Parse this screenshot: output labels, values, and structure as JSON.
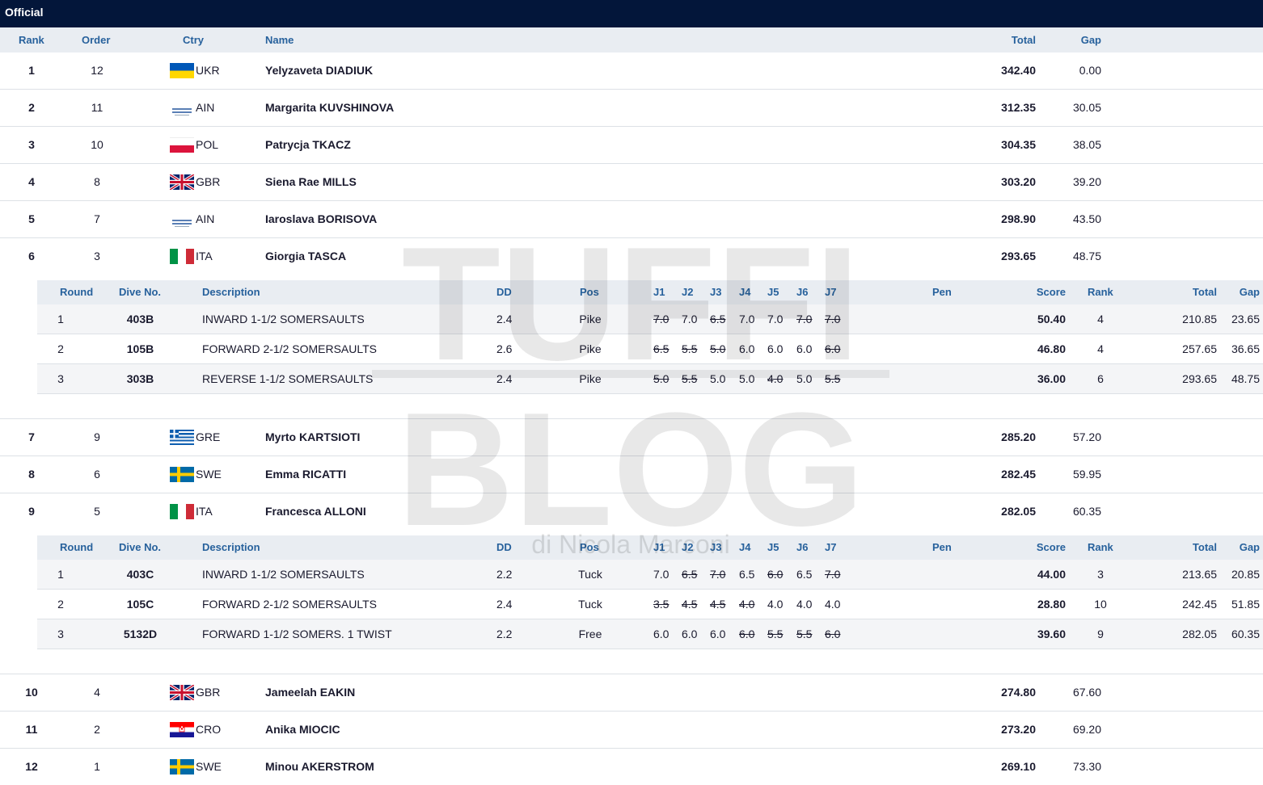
{
  "status": "Official",
  "headers": {
    "rank": "Rank",
    "order": "Order",
    "ctry": "Ctry",
    "name": "Name",
    "total": "Total",
    "gap": "Gap"
  },
  "detail_headers": {
    "round": "Round",
    "dive": "Dive No.",
    "desc": "Description",
    "dd": "DD",
    "pos": "Pos",
    "j1": "J1",
    "j2": "J2",
    "j3": "J3",
    "j4": "J4",
    "j5": "J5",
    "j6": "J6",
    "j7": "J7",
    "pen": "Pen",
    "score": "Score",
    "rank": "Rank",
    "total": "Total",
    "gap": "Gap"
  },
  "rows": [
    {
      "rank": "1",
      "order": "12",
      "ctry": "UKR",
      "flag": "ukr",
      "name": "Yelyzaveta DIADIUK",
      "total": "342.40",
      "gap": "0.00"
    },
    {
      "rank": "2",
      "order": "11",
      "ctry": "AIN",
      "flag": "ain",
      "name": "Margarita KUVSHINOVA",
      "total": "312.35",
      "gap": "30.05"
    },
    {
      "rank": "3",
      "order": "10",
      "ctry": "POL",
      "flag": "pol",
      "name": "Patrycja TKACZ",
      "total": "304.35",
      "gap": "38.05"
    },
    {
      "rank": "4",
      "order": "8",
      "ctry": "GBR",
      "flag": "gbr",
      "name": "Siena Rae MILLS",
      "total": "303.20",
      "gap": "39.20"
    },
    {
      "rank": "5",
      "order": "7",
      "ctry": "AIN",
      "flag": "ain",
      "name": "Iaroslava BORISOVA",
      "total": "298.90",
      "gap": "43.50"
    },
    {
      "rank": "6",
      "order": "3",
      "ctry": "ITA",
      "flag": "ita",
      "name": "Giorgia TASCA",
      "total": "293.65",
      "gap": "48.75"
    },
    {
      "rank": "7",
      "order": "9",
      "ctry": "GRE",
      "flag": "gre",
      "name": "Myrto KARTSIOTI",
      "total": "285.20",
      "gap": "57.20"
    },
    {
      "rank": "8",
      "order": "6",
      "ctry": "SWE",
      "flag": "swe",
      "name": "Emma RICATTI",
      "total": "282.45",
      "gap": "59.95"
    },
    {
      "rank": "9",
      "order": "5",
      "ctry": "ITA",
      "flag": "ita",
      "name": "Francesca ALLONI",
      "total": "282.05",
      "gap": "60.35"
    },
    {
      "rank": "10",
      "order": "4",
      "ctry": "GBR",
      "flag": "gbr",
      "name": "Jameelah EAKIN",
      "total": "274.80",
      "gap": "67.60"
    },
    {
      "rank": "11",
      "order": "2",
      "ctry": "CRO",
      "flag": "cro",
      "name": "Anika MIOCIC",
      "total": "273.20",
      "gap": "69.20"
    },
    {
      "rank": "12",
      "order": "1",
      "ctry": "SWE",
      "flag": "swe",
      "name": "Minou AKERSTROM",
      "total": "269.10",
      "gap": "73.30"
    }
  ],
  "details": {
    "tasca": [
      {
        "round": "1",
        "dive": "403B",
        "desc": "INWARD 1-1/2 SOMERSAULTS",
        "dd": "2.4",
        "pos": "Pike",
        "j": [
          "7.0",
          "7.0",
          "6.5",
          "7.0",
          "7.0",
          "7.0",
          "7.0"
        ],
        "struck": [
          true,
          false,
          true,
          false,
          false,
          true,
          true
        ],
        "score": "50.40",
        "rank": "4",
        "total": "210.85",
        "gap": "23.65"
      },
      {
        "round": "2",
        "dive": "105B",
        "desc": "FORWARD 2-1/2 SOMERSAULTS",
        "dd": "2.6",
        "pos": "Pike",
        "j": [
          "6.5",
          "5.5",
          "5.0",
          "6.0",
          "6.0",
          "6.0",
          "6.0"
        ],
        "struck": [
          true,
          true,
          true,
          false,
          false,
          false,
          true
        ],
        "score": "46.80",
        "rank": "4",
        "total": "257.65",
        "gap": "36.65"
      },
      {
        "round": "3",
        "dive": "303B",
        "desc": "REVERSE 1-1/2 SOMERSAULTS",
        "dd": "2.4",
        "pos": "Pike",
        "j": [
          "5.0",
          "5.5",
          "5.0",
          "5.0",
          "4.0",
          "5.0",
          "5.5"
        ],
        "struck": [
          true,
          true,
          false,
          false,
          true,
          false,
          true
        ],
        "score": "36.00",
        "rank": "6",
        "total": "293.65",
        "gap": "48.75"
      }
    ],
    "alloni": [
      {
        "round": "1",
        "dive": "403C",
        "desc": "INWARD 1-1/2 SOMERSAULTS",
        "dd": "2.2",
        "pos": "Tuck",
        "j": [
          "7.0",
          "6.5",
          "7.0",
          "6.5",
          "6.0",
          "6.5",
          "7.0"
        ],
        "struck": [
          false,
          true,
          true,
          false,
          true,
          false,
          true
        ],
        "score": "44.00",
        "rank": "3",
        "total": "213.65",
        "gap": "20.85"
      },
      {
        "round": "2",
        "dive": "105C",
        "desc": "FORWARD 2-1/2 SOMERSAULTS",
        "dd": "2.4",
        "pos": "Tuck",
        "j": [
          "3.5",
          "4.5",
          "4.5",
          "4.0",
          "4.0",
          "4.0",
          "4.0"
        ],
        "struck": [
          true,
          true,
          true,
          true,
          false,
          false,
          false
        ],
        "score": "28.80",
        "rank": "10",
        "total": "242.45",
        "gap": "51.85"
      },
      {
        "round": "3",
        "dive": "5132D",
        "desc": "FORWARD 1-1/2 SOMERS. 1 TWIST",
        "dd": "2.2",
        "pos": "Free",
        "j": [
          "6.0",
          "6.0",
          "6.0",
          "6.0",
          "5.5",
          "5.5",
          "6.0"
        ],
        "struck": [
          false,
          false,
          false,
          true,
          true,
          true,
          true
        ],
        "score": "39.60",
        "rank": "9",
        "total": "282.05",
        "gap": "60.35"
      }
    ]
  },
  "watermark": {
    "line1": "TUFFI",
    "line2": "BLOG",
    "sub": "di Nicola Marconi"
  }
}
